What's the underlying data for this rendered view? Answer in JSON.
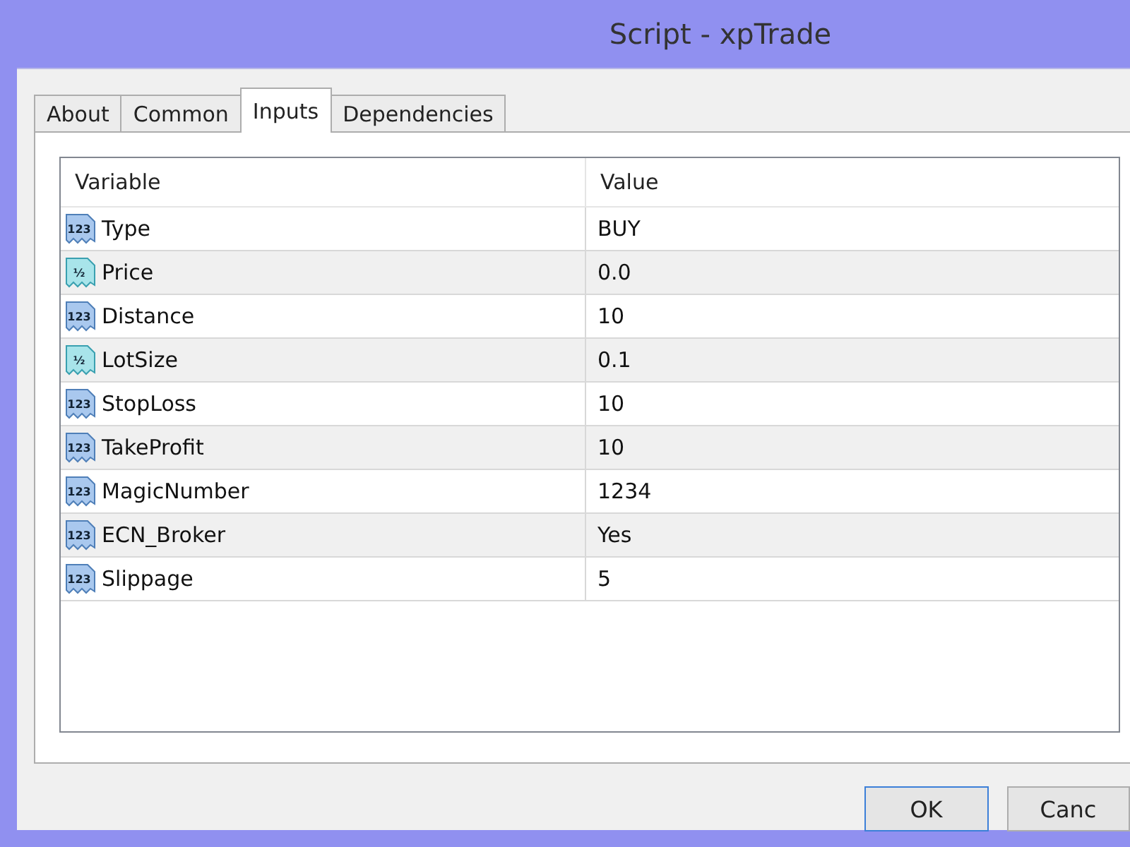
{
  "window": {
    "title": "Script - xpTrade"
  },
  "tabs": [
    {
      "label": "About",
      "selected": false
    },
    {
      "label": "Common",
      "selected": false
    },
    {
      "label": "Inputs",
      "selected": true
    },
    {
      "label": "Dependencies",
      "selected": false
    }
  ],
  "table": {
    "columns": [
      "Variable",
      "Value"
    ],
    "rows": [
      {
        "kind": "int",
        "icon_label": "123",
        "variable": "Type",
        "value": "BUY"
      },
      {
        "kind": "double",
        "icon_label": "½",
        "variable": "Price",
        "value": "0.0"
      },
      {
        "kind": "int",
        "icon_label": "123",
        "variable": "Distance",
        "value": "10"
      },
      {
        "kind": "double",
        "icon_label": "½",
        "variable": "LotSize",
        "value": "0.1"
      },
      {
        "kind": "int",
        "icon_label": "123",
        "variable": "StopLoss",
        "value": "10"
      },
      {
        "kind": "int",
        "icon_label": "123",
        "variable": "TakeProfit",
        "value": "10"
      },
      {
        "kind": "int",
        "icon_label": "123",
        "variable": "MagicNumber",
        "value": "1234"
      },
      {
        "kind": "int",
        "icon_label": "123",
        "variable": "ECN_Broker",
        "value": "Yes"
      },
      {
        "kind": "int",
        "icon_label": "123",
        "variable": "Slippage",
        "value": "5"
      }
    ]
  },
  "buttons": [
    {
      "label": "OK",
      "focused": true
    },
    {
      "label": "Canc",
      "focused": false
    }
  ]
}
